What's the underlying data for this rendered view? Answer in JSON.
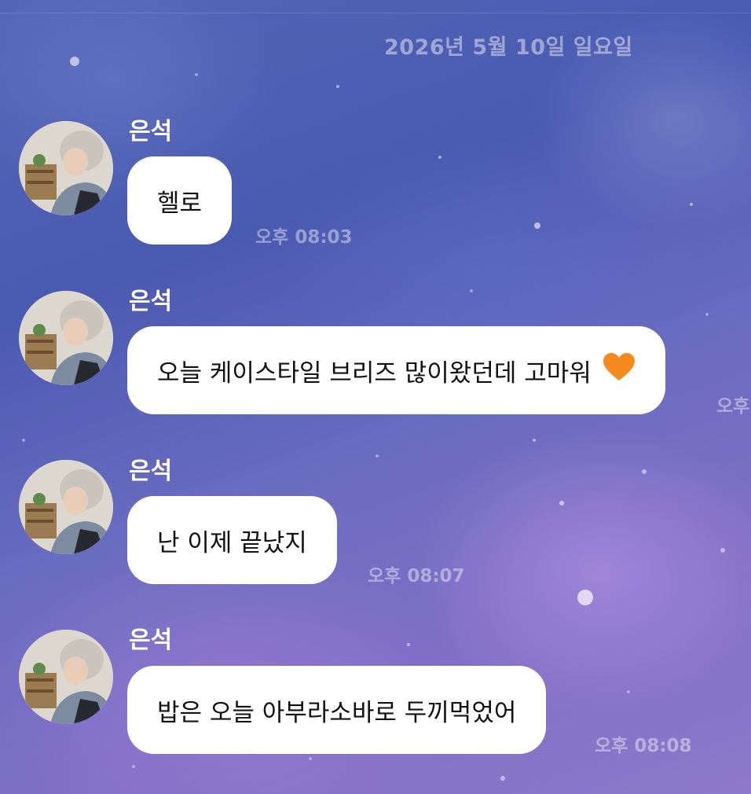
{
  "chat": {
    "date_header": "2026년 5월 10일 일요일",
    "messages": [
      {
        "sender": "은석",
        "text": "헬로",
        "time": "오후 08:03"
      },
      {
        "sender": "은석",
        "text": "오늘 케이스타일 브리즈 많이왔던데 고마워",
        "emoji": "orange-heart-icon",
        "time": "오후"
      },
      {
        "sender": "은석",
        "text": "난 이제 끝났지",
        "time": "오후 08:07"
      },
      {
        "sender": "은석",
        "text": "밥은 오늘 아부라소바로 두끼먹었어",
        "time": "오후 08:08"
      }
    ]
  },
  "colors": {
    "bubble": "#ffffff",
    "text": "#111111",
    "heart": "#f58a1f"
  }
}
